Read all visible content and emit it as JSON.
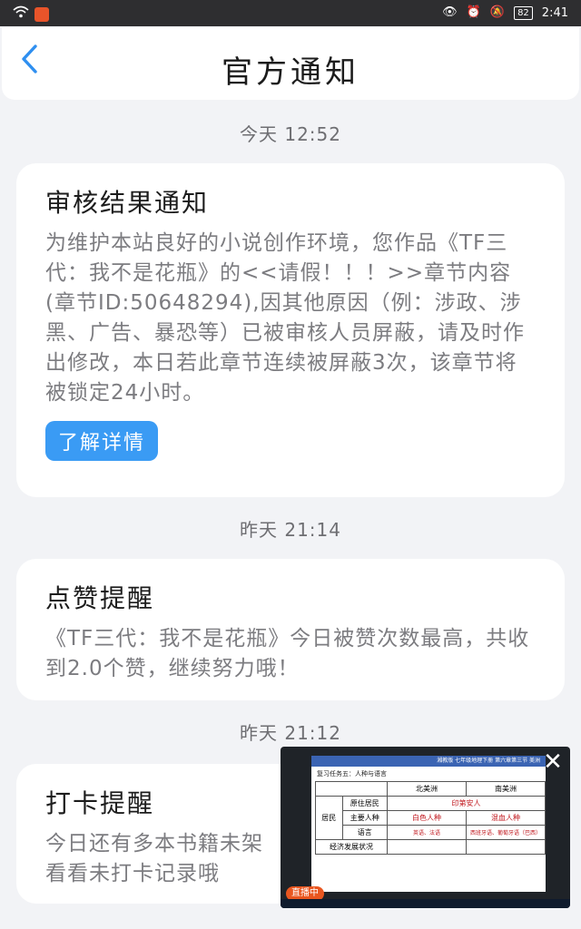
{
  "status_bar": {
    "time": "2:41",
    "battery": "82"
  },
  "header": {
    "back_icon": "chevron-left-icon",
    "title": "官方通知"
  },
  "accent_color": "#3a9bf4",
  "notifications": [
    {
      "time": "今天 12:52",
      "title": "审核结果通知",
      "body": "为维护本站良好的小说创作环境，您作品《TF三代：我不是花瓶》的<<请假！！！>>章节内容(章节ID:50648294),因其他原因（例：涉政、涉黑、广告、暴恐等）已被审核人员屏蔽，请及时作出修改，本日若此章节连续被屏蔽3次，该章节将被锁定24小时。",
      "button": "了解详情"
    },
    {
      "time": "昨天 21:14",
      "title": "点赞提醒",
      "body": "《TF三代：我不是花瓶》今日被赞次数最高，共收到2.0个赞，继续努力哦！"
    },
    {
      "time": "昨天 21:12",
      "title": "打卡提醒",
      "body": "今日还有多本书籍未架看看未打卡记录哦"
    }
  ],
  "pip": {
    "close_icon": "close-icon",
    "live_badge": "直播中",
    "slide_header": "湘教版 七年级地理下册 第六章第三节 美洲",
    "slide_subtitle": "复习任务五：人种与语言",
    "table": {
      "columns": [
        "",
        "",
        "北美洲",
        "南美洲"
      ],
      "row_group": "居民",
      "rows": [
        {
          "label": "原住居民",
          "north": "印第安人",
          "south": ""
        },
        {
          "label": "主要人种",
          "north": "白色人种",
          "south": "混血人种"
        },
        {
          "label": "语言",
          "north": "英语、法语",
          "south": "西班牙语、葡萄牙语（巴西）"
        }
      ],
      "last_row": "经济发展状况"
    }
  }
}
